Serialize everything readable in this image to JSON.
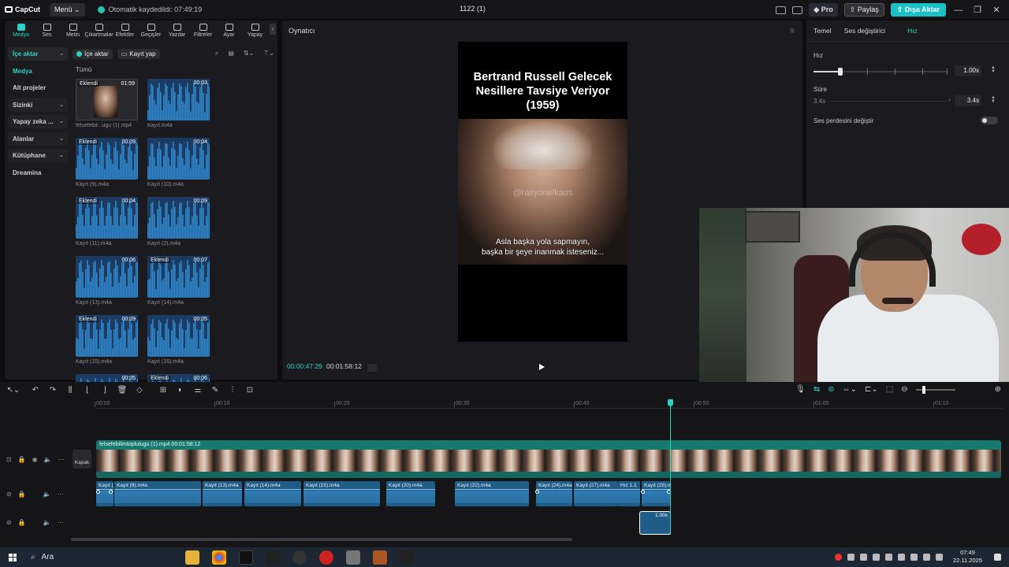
{
  "app": {
    "logo_text": "CapCut",
    "menu_label": "Menü",
    "autosave_text": "Otomatik kaydedildi: 07:49:19",
    "project_title": "1122 (1)",
    "pro_label": "Pro",
    "share_label": "Paylaş",
    "export_label": "Dışa Aktar",
    "accent": "#2ed1c4"
  },
  "toolbar": [
    {
      "label": "Medya",
      "icon": "media-icon",
      "active": true
    },
    {
      "label": "Ses",
      "icon": "audio-icon"
    },
    {
      "label": "Metin",
      "icon": "text-icon"
    },
    {
      "label": "Çıkartmalar",
      "icon": "sticker-icon"
    },
    {
      "label": "Efektler",
      "icon": "effects-icon"
    },
    {
      "label": "Geçişler",
      "icon": "transition-icon"
    },
    {
      "label": "Yazılar",
      "icon": "captions-icon"
    },
    {
      "label": "Filtreler",
      "icon": "filter-icon"
    },
    {
      "label": "Ayar",
      "icon": "adjust-icon"
    },
    {
      "label": "Yapay",
      "icon": "ai-icon"
    }
  ],
  "sidenav": [
    {
      "label": "İçe aktar",
      "active": true,
      "chevron": true
    },
    {
      "label": "Medya",
      "sub": true
    },
    {
      "label": "Alt projeler"
    },
    {
      "label": "Sizinki",
      "chevron": true
    },
    {
      "label": "Yapay zeka ...",
      "chevron": true
    },
    {
      "label": "Alanlar",
      "chevron": true
    },
    {
      "label": "Kütüphane",
      "chevron": true
    },
    {
      "label": "Dreamina"
    }
  ],
  "media": {
    "import_label": "İçe aktar",
    "record_label": "Kayıt yap",
    "all_label": "Tümü",
    "items": [
      {
        "name": "felsefebil...ugu (1).mp4",
        "duration": "01:59",
        "badge": "Eklendi",
        "video": true
      },
      {
        "name": "Kayıt.m4a",
        "duration": "00:03"
      },
      {
        "name": "Kayıt (9).m4a",
        "duration": "00:09",
        "badge": "Eklendi"
      },
      {
        "name": "Kayıt (10).m4a",
        "duration": "00:04"
      },
      {
        "name": "Kayıt (11).m4a",
        "duration": "00:04",
        "badge": "Eklendi"
      },
      {
        "name": "Kayıt (2).m4a",
        "duration": "00:09"
      },
      {
        "name": "Kayıt (13).m4a",
        "duration": "00:06"
      },
      {
        "name": "Kayıt (14).m4a",
        "duration": "00:07",
        "badge": "Eklendi"
      },
      {
        "name": "Kayıt (15).m4a",
        "duration": "00:09",
        "badge": "Eklendi"
      },
      {
        "name": "Kayıt (16).m4a",
        "duration": "00:05"
      },
      {
        "name": "",
        "duration": "00:05"
      },
      {
        "name": "",
        "duration": "00:06",
        "badge": "Eklendi"
      }
    ]
  },
  "player": {
    "title": "Oynatıcı",
    "video_title": "Bertrand Russell Gelecek Nesillere Tavsiye Veriyor (1959)",
    "watermark": "@rasyonelkaos",
    "subtitle_line1": "Asla başka yola sapmayın,",
    "subtitle_line2": "başka bir şeye inanmak isteseniz...",
    "current_time": "00:00:47:29",
    "total_time": "00:01:58:12"
  },
  "right_panel": {
    "tabs": [
      "Temel",
      "Ses değiştirici",
      "Hız"
    ],
    "active_tab": 2,
    "speed_label": "Hız",
    "speed_value": "1.00x",
    "speed_fraction": 0.2,
    "duration_label": "Süre",
    "duration_from": "3.4s",
    "duration_value": "3.4s",
    "pitch_label": "Ses perdesini değiştir",
    "pitch_on": false
  },
  "timeline": {
    "ruler": [
      "00:00",
      "00:10",
      "00:20",
      "00:30",
      "00:40",
      "00:50",
      "01:00",
      "01:10"
    ],
    "cover_label": "Kapak",
    "video_clip_label": "felsefebilimtoplulugu (1).mp4   00:01:58:12",
    "audio_clips": [
      {
        "label": "Kayıt (",
        "start": 0.0,
        "len": 0.9
      },
      {
        "label": "Kayıt (9).m4a",
        "start": 0.9,
        "len": 4.2
      },
      {
        "label": "Kayıt (13).m4a",
        "start": 5.5,
        "len": 1.6
      },
      {
        "label": "Kayıt (14).m4a",
        "start": 7.1,
        "len": 2.5
      },
      {
        "label": "Kayıt (15).m4a",
        "start": 10.4,
        "len": 3.1
      },
      {
        "label": "Kayıt (20).m4a",
        "start": 14.4,
        "len": 2.0
      },
      {
        "label": "Kayıt (22).m4a",
        "start": 20.0,
        "len": 3.1
      },
      {
        "label": "Kayıt (24).m4a",
        "start": 22.5,
        "len": 1.5
      },
      {
        "label": "Kayıt (27).m4a",
        "start": 24.0,
        "len": 2.7
      },
      {
        "label": "Hız 1.1",
        "start": 26.7,
        "len": 0.6
      },
      {
        "label": "Kayıt (28).m",
        "start": 27.3,
        "len": 1.2
      }
    ],
    "selected_clip_label": "1.00x"
  },
  "taskbar": {
    "search_label": "Ara",
    "time": "07:49",
    "date": "22.11.2025"
  }
}
